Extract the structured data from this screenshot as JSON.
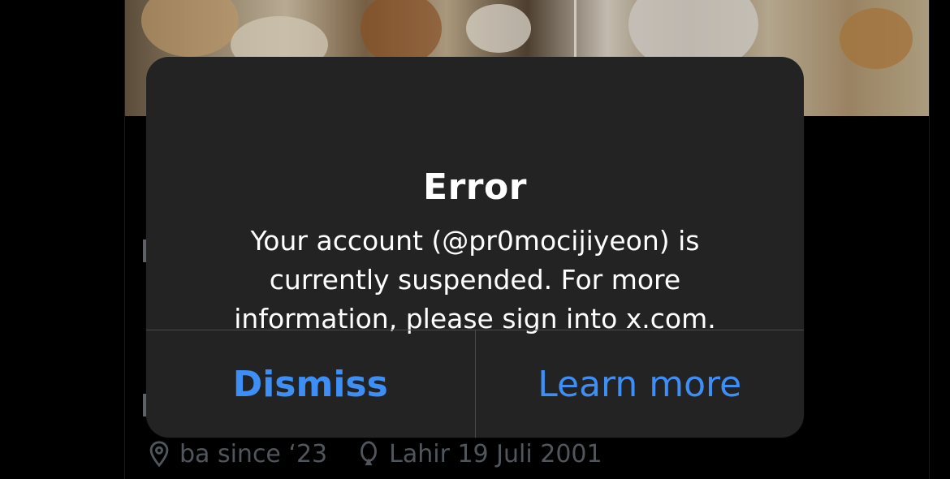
{
  "alert": {
    "title": "Error",
    "message": "Your account (@pr0mocijiyeon) is currently suspended. For more information, please sign into x.com.",
    "dismiss_label": "Dismiss",
    "learn_more_label": "Learn more"
  },
  "profile": {
    "location": "ba since ‘23",
    "birthday": "Lahir 19 Juli 2001"
  },
  "colors": {
    "alert_background": "#232323",
    "button_text": "#3d8ff5",
    "meta_text": "#5f656b"
  },
  "icons": {
    "location": "location-pin-icon",
    "birthday": "balloon-icon"
  }
}
